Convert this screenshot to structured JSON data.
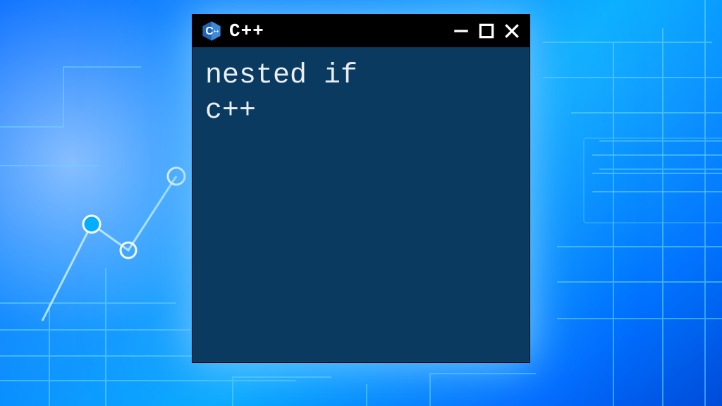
{
  "window": {
    "title": "C++",
    "logo_letter": "C",
    "logo_plus": "++",
    "controls": {
      "minimize": "minimize",
      "maximize": "maximize",
      "close": "close"
    }
  },
  "content": {
    "line1": "nested if",
    "line2": "c++"
  },
  "colors": {
    "titlebar_bg": "#000000",
    "window_bg": "#0a3a5f",
    "text": "#e9eef2",
    "logo_hex": "#1f64b5",
    "logo_hex_light": "#3d8bd6",
    "glow": "#7fd4ff"
  }
}
